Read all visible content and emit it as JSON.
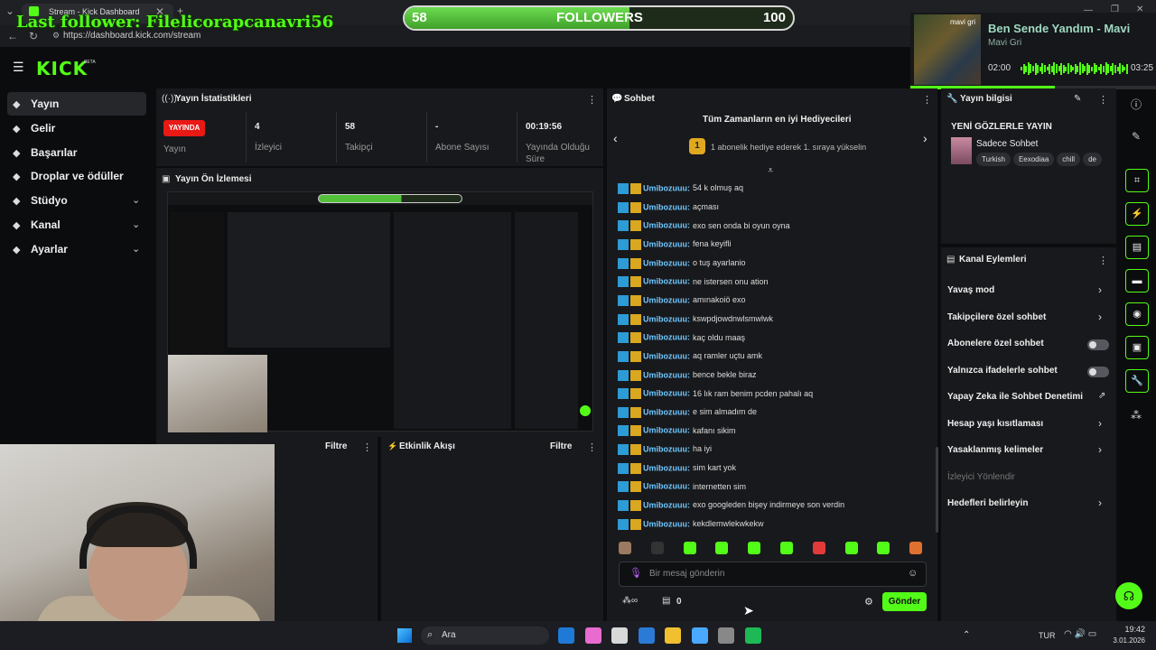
{
  "browser": {
    "tab_title": "Stream - Kick Dashboard",
    "url": "https://dashboard.kick.com/stream"
  },
  "overlay": {
    "last_follower": "Last follower: Filelicorapcanavri56",
    "follow_goal": {
      "current": "58",
      "label": "FOLLOWERS",
      "target": "100",
      "fraction": 0.58
    }
  },
  "music": {
    "title": "Ben Sende Yandım - Mavi",
    "artist": "Mavi Gri",
    "elapsed": "02:00",
    "duration": "03:25",
    "progress": 0.59,
    "art_text": "mavi gri"
  },
  "kick": {
    "logo": "KICK",
    "beta": "BETA"
  },
  "sidebar": {
    "items": [
      {
        "label": "Yayın",
        "icon": "broadcast-icon",
        "expand": false
      },
      {
        "label": "Gelir",
        "icon": "dollar-icon",
        "expand": false
      },
      {
        "label": "Başarılar",
        "icon": "trophy-icon",
        "expand": false
      },
      {
        "label": "Droplar ve ödüller",
        "icon": "gift-icon",
        "expand": false
      },
      {
        "label": "Stüdyo",
        "icon": "sliders-icon",
        "expand": true
      },
      {
        "label": "Kanal",
        "icon": "video-icon",
        "expand": true
      },
      {
        "label": "Ayarlar",
        "icon": "gear-icon",
        "expand": true
      }
    ]
  },
  "stats": {
    "title": "Yayın İstatistikleri",
    "live_badge": "YAYINDA",
    "live_label": "Yayın",
    "items": [
      {
        "value": "4",
        "label": "İzleyici"
      },
      {
        "value": "58",
        "label": "Takipçi"
      },
      {
        "value": "-",
        "label": "Abone Sayısı"
      },
      {
        "value": "00:19:56",
        "label": "Yayında Olduğu Süre"
      }
    ]
  },
  "preview": {
    "title": "Yayın Ön İzlemesi"
  },
  "bottom_panels": {
    "left_filter": "Filtre",
    "activity_title": "Etkinlik Akışı",
    "activity_filter": "Filtre"
  },
  "chat": {
    "title": "Sohbet",
    "gifters_title": "Tüm Zamanların en iyi Hediyecileri",
    "gifters_rank": "1",
    "gifters_text": "1 abonelik hediye ederek 1. sıraya yükselin",
    "username": "Umibozuuu:",
    "messages": [
      "54 k olmuş aq",
      "açması",
      "exo sen onda bi oyun oyna",
      "fena keyifli",
      "o tuş ayarlanio",
      "ne istersen onu ation",
      "amınakoiö exo",
      "kswpdjowdnwlsmwlwk",
      "kaç oldu maaş",
      "aq ramler uçtu amk",
      "bence bekle biraz",
      "16 lık ram benim pcden pahalı aq",
      "e sim almadım de",
      "kafanı sikim",
      "ha iyi",
      "sim kart yok",
      "internetten sim",
      "exo googleden bişey indirmeye son verdin",
      "kekdlemwlekwkekw"
    ],
    "input_placeholder": "Bir mesaj gönderin",
    "points_value": "0",
    "send_label": "Gönder"
  },
  "stream_info": {
    "title": "Yayın bilgisi",
    "heading": "YENİ GÖZLERLE YAYIN",
    "category": "Sadece Sohbet",
    "tags": [
      "Turkish",
      "Eexodiaa",
      "chill",
      "de"
    ]
  },
  "channel_actions": {
    "title": "Kanal Eylemleri",
    "rows": [
      {
        "label": "Yavaş mod",
        "control": "chevron"
      },
      {
        "label": "Takipçilere özel sohbet",
        "control": "chevron"
      },
      {
        "label": "Abonelere özel sohbet",
        "control": "toggle"
      },
      {
        "label": "Yalnızca ifadelerle sohbet",
        "control": "toggle"
      },
      {
        "label": "Yapay Zeka ile Sohbet Denetimi",
        "control": "external"
      },
      {
        "label": "Hesap yaşı kısıtlaması",
        "control": "chevron"
      },
      {
        "label": "Yasaklanmış kelimeler",
        "control": "chevron"
      },
      {
        "label": "İzleyici Yönlendir",
        "control": "none"
      },
      {
        "label": "Hedefleri belirleyin",
        "control": "chevron"
      }
    ]
  },
  "taskbar": {
    "search": "Ara",
    "lang": "TUR",
    "time": "19:42",
    "date": "3.01.2026"
  },
  "colors": {
    "accent": "#53fc18",
    "live": "#e91916",
    "panel": "#18191c",
    "bg": "#0b0c0e"
  }
}
